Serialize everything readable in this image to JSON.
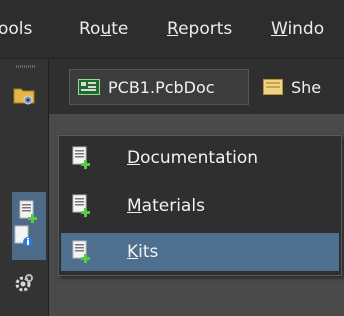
{
  "menubar": {
    "items": [
      {
        "text": "ools",
        "accel": ""
      },
      {
        "pre": "Ro",
        "accel": "u",
        "post": "te"
      },
      {
        "pre": "",
        "accel": "R",
        "post": "eports"
      },
      {
        "pre": "",
        "accel": "W",
        "post": "indo"
      }
    ]
  },
  "tabs": {
    "active_label": "PCB1.PcbDoc",
    "other_label": "She"
  },
  "submenu": {
    "items": [
      {
        "accel": "D",
        "rest": "ocumentation"
      },
      {
        "accel": "M",
        "rest": "aterials"
      },
      {
        "accel": "K",
        "rest": "its"
      }
    ]
  },
  "icons": {
    "toolbar": [
      "folder-gear-icon",
      "document-add-icon",
      "document-info-icon",
      "gear-icon"
    ],
    "submenu": [
      "document-add-icon",
      "document-add-icon",
      "document-add-icon"
    ],
    "tab": [
      "pcb-document-icon",
      "schematic-sheet-icon"
    ]
  },
  "colors": {
    "highlight": "#4f6f8e",
    "toolbar_active": "#4d6b86",
    "plus_green": "#5cc84a"
  }
}
